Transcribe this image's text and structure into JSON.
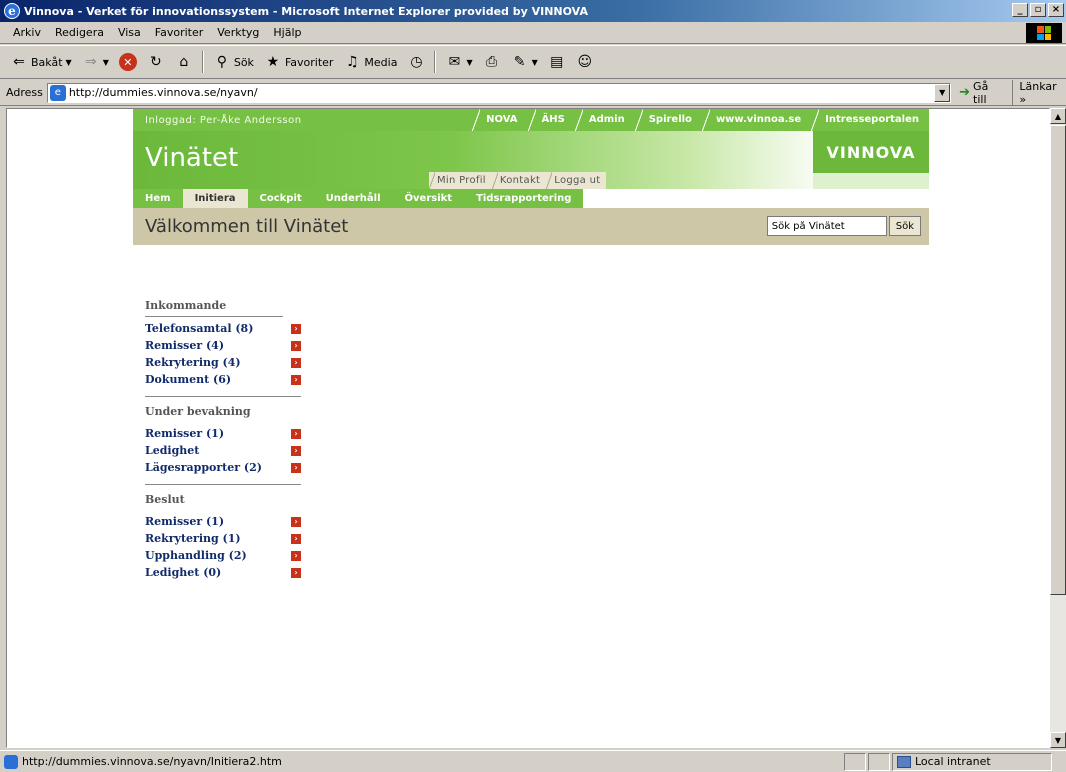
{
  "window": {
    "title": "Vinnova - Verket för innovationssystem - Microsoft Internet Explorer provided by VINNOVA",
    "min": "_",
    "max": "▫",
    "close": "×"
  },
  "menu": [
    "Arkiv",
    "Redigera",
    "Visa",
    "Favoriter",
    "Verktyg",
    "Hjälp"
  ],
  "toolbar": {
    "back": "Bakåt",
    "search": "Sök",
    "favorites": "Favoriter",
    "media": "Media"
  },
  "address": {
    "label": "Adress",
    "url": "http://dummies.vinnova.se/nyavn/",
    "go": "Gå till",
    "links": "Länkar »"
  },
  "status": {
    "text": "http://dummies.vinnova.se/nyavn/Initiera2.htm",
    "zone": "Local intranet"
  },
  "page": {
    "user": "Inloggad: Per-Åke Andersson",
    "top_links": [
      "NOVA",
      "ÄHS",
      "Admin",
      "Spirello",
      "www.vinnoa.se",
      "Intresseportalen"
    ],
    "brand": "Vinätet",
    "logo": "VINNOVA",
    "sub_tabs": [
      "Min Profil",
      "Kontakt",
      "Logga ut"
    ],
    "nav": [
      "Hem",
      "Initiera",
      "Cockpit",
      "Underhåll",
      "Översikt",
      "Tidsrapportering"
    ],
    "active_nav": "Initiera",
    "welcome": "Välkommen till Vinätet",
    "search_placeholder": "Sök på Vinätet",
    "search_button": "Sök"
  },
  "sidebar": {
    "groups": [
      {
        "heading": "Inkommande",
        "items": [
          "Telefonsamtal (8)",
          "Remisser (4)",
          "Rekrytering (4)",
          "Dokument (6)"
        ]
      },
      {
        "heading": "Under bevakning",
        "items": [
          "Remisser (1)",
          "Ledighet",
          "Lägesrapporter (2)"
        ]
      },
      {
        "heading": "Beslut",
        "items": [
          "Remisser (1)",
          "Rekrytering (1)",
          "Upphandling (2)",
          "Ledighet (0)"
        ]
      }
    ]
  },
  "colors": {
    "green": "#76c043",
    "beige": "#cdc6a7",
    "link": "#102a6a",
    "arrow": "#c8321a"
  }
}
